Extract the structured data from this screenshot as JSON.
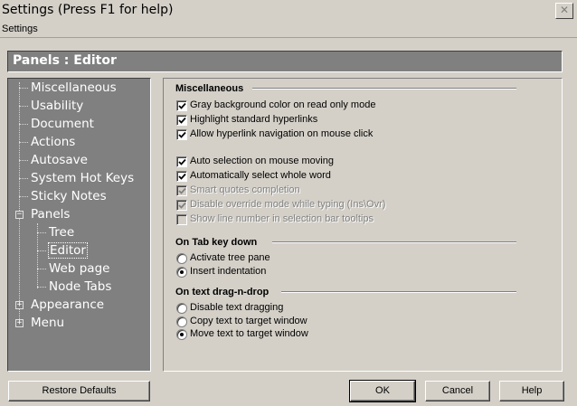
{
  "window": {
    "title": "Settings (Press F1 for help)",
    "close_glyph": "✕"
  },
  "menubar": {
    "items": [
      "Settings"
    ]
  },
  "header": {
    "title": "Panels : Editor"
  },
  "tree": {
    "items": [
      {
        "label": "Miscellaneous"
      },
      {
        "label": "Usability"
      },
      {
        "label": "Document"
      },
      {
        "label": "Actions"
      },
      {
        "label": "Autosave"
      },
      {
        "label": "System Hot Keys"
      },
      {
        "label": "Sticky Notes"
      },
      {
        "label": "Panels",
        "expander": "−"
      },
      {
        "label": "Tree"
      },
      {
        "label": "Editor",
        "selected": true
      },
      {
        "label": "Web page"
      },
      {
        "label": "Node Tabs"
      },
      {
        "label": "Appearance",
        "expander": "+"
      },
      {
        "label": "Menu",
        "expander": "+"
      }
    ]
  },
  "misc": {
    "title": "Miscellaneous",
    "options": [
      {
        "label": "Gray background color on read only mode",
        "checked": true,
        "disabled": false
      },
      {
        "label": "Highlight standard hyperlinks",
        "checked": true,
        "disabled": false
      },
      {
        "label": "Allow hyperlink navigation on mouse click",
        "checked": true,
        "disabled": false
      },
      {
        "label": "Auto selection on mouse moving",
        "checked": true,
        "disabled": false
      },
      {
        "label": "Automatically select whole word",
        "checked": true,
        "disabled": false
      },
      {
        "label": "Smart quotes completion",
        "checked": true,
        "disabled": true
      },
      {
        "label": "Disable override mode while typing (Ins\\Ovr)",
        "checked": true,
        "disabled": true
      },
      {
        "label": "Show line number in selection bar tooltips",
        "checked": false,
        "disabled": true
      }
    ]
  },
  "tabkey": {
    "title": "On Tab key down",
    "options": [
      {
        "label": "Activate tree pane",
        "selected": false
      },
      {
        "label": "Insert indentation",
        "selected": true
      }
    ]
  },
  "dragdrop": {
    "title": "On text drag-n-drop",
    "options": [
      {
        "label": "Disable text dragging",
        "selected": false
      },
      {
        "label": "Copy text to target window",
        "selected": false
      },
      {
        "label": "Move text to target window",
        "selected": true
      }
    ]
  },
  "buttons": {
    "restore": "Restore Defaults",
    "ok": "OK",
    "cancel": "Cancel",
    "help": "Help"
  }
}
